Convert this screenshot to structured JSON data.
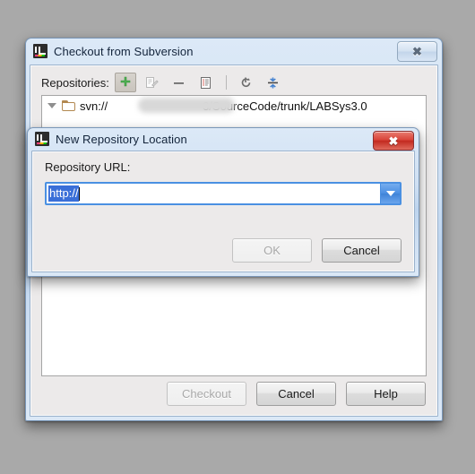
{
  "desktop": {
    "background": "#a9a9a9"
  },
  "outer_dialog": {
    "title": "Checkout from Subversion",
    "app_icon": "intellij-idea-icon",
    "close_icon": "close-icon",
    "toolbar": {
      "label": "Repositories:",
      "buttons": [
        {
          "name": "add-repository-button",
          "icon": "plus-icon",
          "state": "selected"
        },
        {
          "name": "edit-repository-button",
          "icon": "edit-document-icon",
          "state": "disabled"
        },
        {
          "name": "remove-repository-button",
          "icon": "minus-icon",
          "state": "enabled"
        },
        {
          "name": "repository-details-button",
          "icon": "document-details-icon",
          "state": "enabled"
        },
        {
          "name": "refresh-button",
          "icon": "refresh-icon",
          "state": "enabled"
        },
        {
          "name": "collapse-all-button",
          "icon": "collapse-all-icon",
          "state": "enabled"
        }
      ]
    },
    "tree": {
      "items": [
        {
          "expander": "expanded",
          "icon": "folder-icon",
          "prefix": "svn://",
          "redacted": true,
          "suffix": "3/SourceCode/trunk/LABSys3.0"
        }
      ]
    },
    "buttons": [
      {
        "label": "Checkout",
        "state": "disabled"
      },
      {
        "label": "Cancel",
        "state": "enabled"
      },
      {
        "label": "Help",
        "state": "enabled"
      }
    ]
  },
  "inner_dialog": {
    "title": "New Repository Location",
    "app_icon": "intellij-idea-icon",
    "close_icon": "close-icon",
    "field": {
      "label": "Repository URL:",
      "value": "http://",
      "selected_text": "http://",
      "focused": true,
      "dropdown_icon": "chevron-down-icon"
    },
    "buttons": [
      {
        "label": "OK",
        "state": "disabled"
      },
      {
        "label": "Cancel",
        "state": "enabled"
      }
    ]
  },
  "colors": {
    "accent": "#4a90e2",
    "selection": "#3a6fd8",
    "close_red": "#d9453a",
    "title_blue": "#cfe0f3"
  }
}
